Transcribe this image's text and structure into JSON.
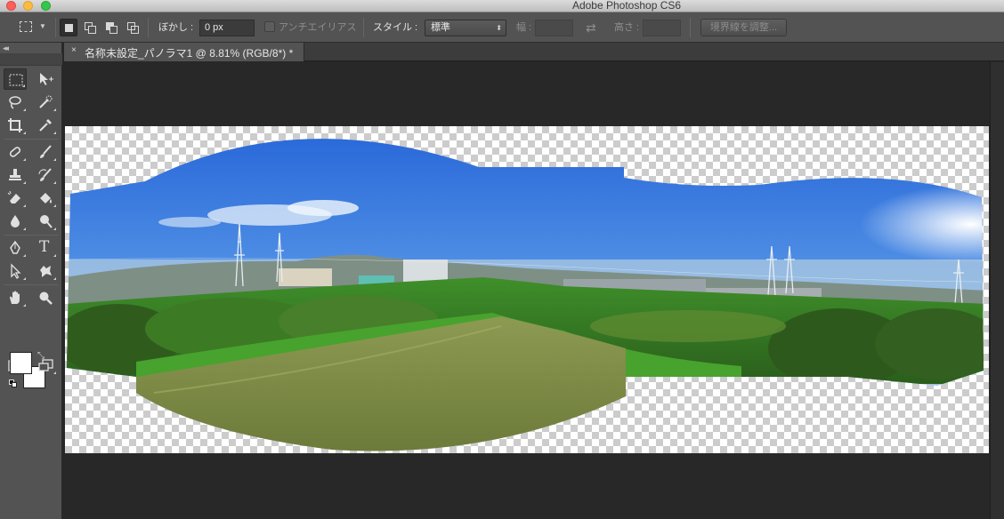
{
  "window": {
    "title": "Adobe Photoshop CS6"
  },
  "options_bar": {
    "feather_label": "ぼかし :",
    "feather_value": "0 px",
    "antialias_label": "アンチエイリアス",
    "style_label": "スタイル :",
    "style_value": "標準",
    "width_label": "幅 :",
    "width_value": "",
    "height_label": "高さ :",
    "height_value": "",
    "refine_edge_button": "境界線を調整..."
  },
  "document_tab": {
    "close_glyph": "×",
    "title": "名称未設定_パノラマ1 @ 8.81% (RGB/8*) *"
  },
  "toolbar": {
    "collapse_glyph": "◂◂",
    "type_tool_glyph": "T",
    "active_tool": "rectangular-marquee",
    "foreground_color": "#ffffff",
    "background_color": "#ffffff"
  },
  "colors": {
    "panel": "#535353",
    "workspace": "#282828",
    "sky_top": "#2f6fe0",
    "sky_bottom": "#bfe0f5",
    "grass": "#3c8a28"
  }
}
